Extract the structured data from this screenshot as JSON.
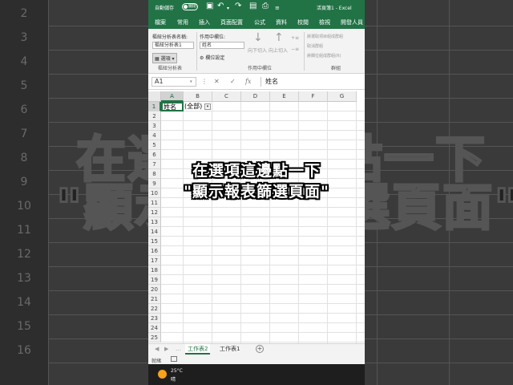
{
  "titlebar": {
    "autosave_label": "自動儲存",
    "autosave_state": "關閉",
    "document_name": "活頁簿1 - Excel"
  },
  "ribbon_tabs": [
    "檔案",
    "常用",
    "插入",
    "頁面配置",
    "公式",
    "資料",
    "校閱",
    "檢視",
    "開發人員"
  ],
  "ribbon": {
    "pivot_name_label": "樞紐分析表名稱:",
    "pivot_name_value": "樞紐分析表1",
    "options_button": "選項",
    "group_pivot": "樞紐分析表",
    "active_field_label": "作用中欄位:",
    "active_field_value": "姓名",
    "field_settings_button": "欄位設定",
    "drill_down": "向下切入",
    "drill_up": "向上切入",
    "group_active_field": "作用中欄位",
    "group_selection": "將選取項目組成群組",
    "ungroup": "取消群組",
    "group_field": "將欄位組成群組(R)",
    "group_grouping": "群組"
  },
  "formula_bar": {
    "name_box": "A1",
    "formula": "姓名"
  },
  "grid": {
    "columns": [
      "A",
      "B",
      "C",
      "D",
      "E",
      "F",
      "G"
    ],
    "rows": [
      "1",
      "2",
      "3",
      "4",
      "5",
      "6",
      "7",
      "8",
      "9",
      "10",
      "11",
      "12",
      "13",
      "14",
      "15",
      "16",
      "17",
      "18",
      "19",
      "20",
      "21",
      "22",
      "23",
      "24",
      "25"
    ],
    "cells": {
      "A1": "姓名",
      "B1": "(全部)"
    }
  },
  "sheets": {
    "tabs": [
      "工作表2",
      "工作表1"
    ],
    "active": "工作表2"
  },
  "status": {
    "ready": "就緒"
  },
  "taskbar": {
    "temperature": "25°C",
    "condition": "晴"
  },
  "caption": {
    "line1": "在選項這邊點一下",
    "line2": "\"顯示報表篩選頁面\""
  },
  "background": {
    "row_numbers": [
      "2",
      "3",
      "4",
      "5",
      "6",
      "7",
      "8",
      "9",
      "10",
      "11",
      "12",
      "13",
      "14",
      "15",
      "16"
    ]
  },
  "colors": {
    "excel_green": "#217346",
    "ribbon_bg": "#f3f3f3",
    "weather_icon": "#f7a21b"
  }
}
